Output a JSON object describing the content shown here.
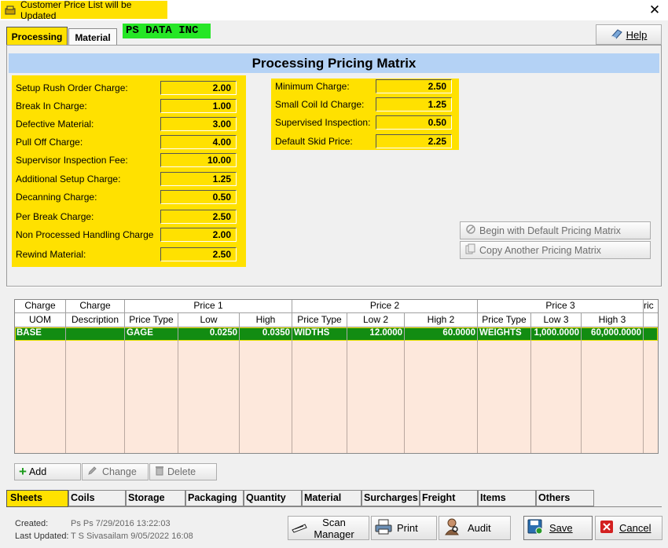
{
  "window": {
    "title": "Customer Price List will be Updated",
    "close_symbol": "✕"
  },
  "tabs_top": [
    {
      "label": "Processing",
      "active": true
    },
    {
      "label": "Material",
      "active": false
    }
  ],
  "company": "PS DATA INC",
  "help_label": "Help",
  "matrix_title": "Processing Pricing Matrix",
  "left_fields": [
    {
      "label": "Setup Rush Order Charge:",
      "value": "2.00"
    },
    {
      "label": "Break In Charge:",
      "value": "1.00"
    },
    {
      "label": "Defective Material:",
      "value": "3.00"
    },
    {
      "label": "Pull Off Charge:",
      "value": "4.00"
    },
    {
      "label": "Supervisor Inspection Fee:",
      "value": "10.00"
    },
    {
      "label": "Additional Setup Charge:",
      "value": "1.25"
    },
    {
      "label": "Decanning Charge:",
      "value": "0.50"
    },
    {
      "label": "Per Break Charge:",
      "value": "2.50"
    },
    {
      "label": "Non Processed Handling Charge",
      "value": "2.00"
    },
    {
      "label": "Rewind Material:",
      "value": "2.50"
    }
  ],
  "right_fields": [
    {
      "label": "Minimum Charge:",
      "value": "2.50"
    },
    {
      "label": "Small Coil Id Charge:",
      "value": "1.25"
    },
    {
      "label": "Supervised Inspection:",
      "value": "0.50"
    },
    {
      "label": "Default Skid Price:",
      "value": "2.25"
    }
  ],
  "matrix_buttons": {
    "begin_default": "Begin with Default Pricing Matrix",
    "copy_another": "Copy Another Pricing Matrix"
  },
  "grid": {
    "group_headers": [
      "Charge",
      "Charge",
      "Price 1",
      "Price 2",
      "Price 3",
      "ric"
    ],
    "sub_headers": [
      "UOM",
      "Description",
      "Price Type",
      "Low",
      "High",
      "Price Type",
      "Low 2",
      "High 2",
      "Price Type",
      "Low 3",
      "High 3",
      ""
    ],
    "rows": [
      [
        "BASE",
        "",
        "GAGE",
        "0.0250",
        "0.0350",
        "WIDTHS",
        "12.0000",
        "60.0000",
        "WEIGHTS",
        "1,000.0000",
        "60,000.0000",
        ""
      ]
    ]
  },
  "grid_buttons": {
    "add": "Add",
    "change": "Change",
    "delete": "Delete"
  },
  "bottom_tabs": [
    "Sheets",
    "Coils",
    "Storage",
    "Packaging",
    "Quantity",
    "Material",
    "Surcharges",
    "Freight",
    "Items",
    "Others"
  ],
  "footer": {
    "created_label": "Created:",
    "created_value": "Ps Ps 7/29/2016 13:22:03",
    "updated_label": "Last Updated:",
    "updated_value": "T S Sivasailam 9/05/2022 16:08",
    "scan_label": "Scan Manager",
    "print_label": "Print",
    "audit_label": "Audit",
    "save_label": "Save",
    "cancel_label": "Cancel"
  },
  "colors": {
    "highlight": "#ffe100",
    "brand_green": "#26e626",
    "row_green": "#128c12",
    "grid_bg": "#fde8dc",
    "title_bar": "#b4d2f5"
  }
}
